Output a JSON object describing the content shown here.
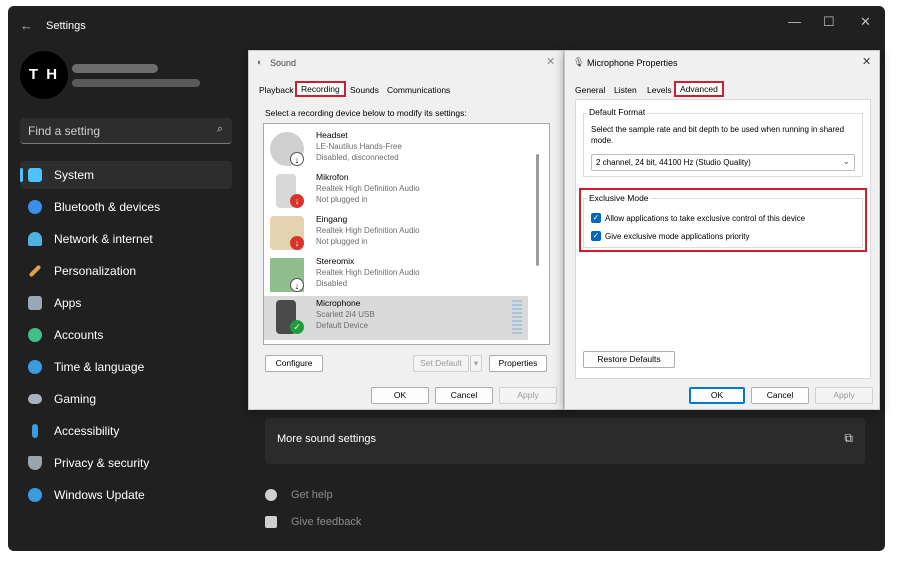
{
  "settings": {
    "title": "Settings",
    "back_icon": "arrow-left-icon",
    "window_controls": [
      "—",
      "☐",
      "✕"
    ],
    "avatar_initials": "T H",
    "search_placeholder": "Find a setting",
    "nav": [
      {
        "label": "System",
        "icon": "system-icon",
        "color": "#4cc2ff",
        "active": true
      },
      {
        "label": "Bluetooth & devices",
        "icon": "bluetooth-icon",
        "color": "#3b8eea"
      },
      {
        "label": "Network & internet",
        "icon": "wifi-icon",
        "color": "#4fb2e0"
      },
      {
        "label": "Personalization",
        "icon": "brush-icon",
        "color": "#e0a14b"
      },
      {
        "label": "Apps",
        "icon": "apps-icon",
        "color": "#9aa7b4"
      },
      {
        "label": "Accounts",
        "icon": "person-icon",
        "color": "#3fbf8a"
      },
      {
        "label": "Time & language",
        "icon": "globe-clock-icon",
        "color": "#3a9be0"
      },
      {
        "label": "Gaming",
        "icon": "gamepad-icon",
        "color": "#a9b1ba"
      },
      {
        "label": "Accessibility",
        "icon": "accessibility-icon",
        "color": "#3a9be0"
      },
      {
        "label": "Privacy & security",
        "icon": "shield-icon",
        "color": "#9aa4ad"
      },
      {
        "label": "Windows Update",
        "icon": "update-icon",
        "color": "#3a9be0"
      }
    ],
    "more_sound": "More sound settings",
    "help": "Get help",
    "feedback": "Give feedback"
  },
  "sound_dialog": {
    "title": "Sound",
    "tabs": [
      "Playback",
      "Recording",
      "Sounds",
      "Communications"
    ],
    "active_tab": "Recording",
    "instruction": "Select a recording device below to modify its settings:",
    "devices": [
      {
        "name": "Headset",
        "line1": "LE-Nautilus Hands-Free",
        "line2": "Disabled, disconnected",
        "badge": "down"
      },
      {
        "name": "Mikrofon",
        "line1": "Realtek High Definition Audio",
        "line2": "Not plugged in",
        "badge": "red"
      },
      {
        "name": "Eingang",
        "line1": "Realtek High Definition Audio",
        "line2": "Not plugged in",
        "badge": "red"
      },
      {
        "name": "Stereomix",
        "line1": "Realtek High Definition Audio",
        "line2": "Disabled",
        "badge": "down"
      },
      {
        "name": "Microphone",
        "line1": "Scarlett 2i4 USB",
        "line2": "Default Device",
        "badge": "green",
        "selected": true
      }
    ],
    "buttons": {
      "configure": "Configure",
      "set_default": "Set Default",
      "properties": "Properties",
      "ok": "OK",
      "cancel": "Cancel",
      "apply": "Apply"
    }
  },
  "mic_dialog": {
    "title": "Microphone Properties",
    "tabs": [
      "General",
      "Listen",
      "Levels",
      "Advanced"
    ],
    "active_tab": "Advanced",
    "default_format_label": "Default Format",
    "format_desc": "Select the sample rate and bit depth to be used when running in shared mode.",
    "format_value": "2 channel, 24 bit, 44100 Hz (Studio Quality)",
    "exclusive_label": "Exclusive Mode",
    "exclusive_options": [
      {
        "label": "Allow applications to take exclusive control of this device",
        "checked": true
      },
      {
        "label": "Give exclusive mode applications priority",
        "checked": true
      }
    ],
    "restore": "Restore Defaults",
    "buttons": {
      "ok": "OK",
      "cancel": "Cancel",
      "apply": "Apply"
    }
  },
  "colors": {
    "highlight_red": "#cf1f2e",
    "accent": "#0067c0"
  }
}
